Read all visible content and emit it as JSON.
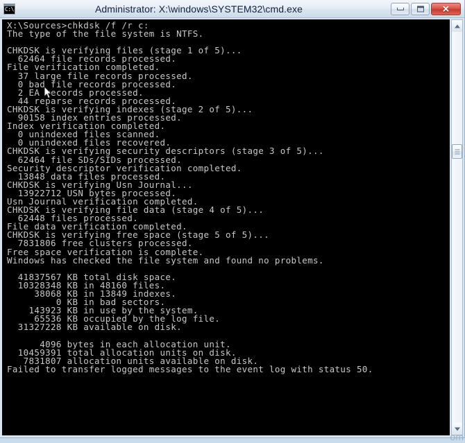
{
  "window": {
    "title": "Administrator: X:\\windows\\SYSTEM32\\cmd.exe",
    "icon_name": "cmd-prompt-icon",
    "icon_text": "C:\\.",
    "minimize_label": "Minimize",
    "maximize_label": "Maximize",
    "close_label": "Close",
    "close_glyph": "✕",
    "colors": {
      "titlebar_top": "#f2f6fb",
      "titlebar_bottom": "#cfdbe9",
      "title_text": "#11223b",
      "close_button": "#c43a2e",
      "console_background": "#000000",
      "console_text": "#c8c8c8",
      "window_border": "#91b4cf",
      "desktop": "#b9d3e8"
    }
  },
  "console": {
    "prompt": "X:\\Sources>",
    "command": "chkdsk /f /r c:",
    "lines": [
      "X:\\Sources>chkdsk /f /r c:",
      "The type of the file system is NTFS.",
      "",
      "CHKDSK is verifying files (stage 1 of 5)...",
      "  62464 file records processed.",
      "File verification completed.",
      "  37 large file records processed.",
      "  0 bad file records processed.",
      "  2 EA records processed.",
      "  44 reparse records processed.",
      "CHKDSK is verifying indexes (stage 2 of 5)...",
      "  90158 index entries processed.",
      "Index verification completed.",
      "  0 unindexed files scanned.",
      "  0 unindexed files recovered.",
      "CHKDSK is verifying security descriptors (stage 3 of 5)...",
      "  62464 file SDs/SIDs processed.",
      "Security descriptor verification completed.",
      "  13848 data files processed.",
      "CHKDSK is verifying Usn Journal...",
      "  13922712 USN bytes processed.",
      "Usn Journal verification completed.",
      "CHKDSK is verifying file data (stage 4 of 5)...",
      "  62448 files processed.",
      "File data verification completed.",
      "CHKDSK is verifying free space (stage 5 of 5)...",
      "  7831806 free clusters processed.",
      "Free space verification is complete.",
      "Windows has checked the file system and found no problems.",
      "",
      "  41837567 KB total disk space.",
      "  10328348 KB in 48160 files.",
      "     38068 KB in 13849 indexes.",
      "         0 KB in bad sectors.",
      "    143923 KB in use by the system.",
      "     65536 KB occupied by the log file.",
      "  31327228 KB available on disk.",
      "",
      "      4096 bytes in each allocation unit.",
      "  10459391 total allocation units on disk.",
      "   7831807 allocation units available on disk."
    ],
    "final_line": "Failed to transfer logged messages to the event log with status 50.",
    "stats": {
      "total_disk_space_kb": 41837567,
      "in_files_kb": 10328348,
      "file_count": 48160,
      "in_indexes_kb": 38068,
      "index_count": 13849,
      "bad_sectors_kb": 0,
      "in_use_by_system_kb": 143923,
      "log_file_kb": 65536,
      "available_kb": 31327228,
      "bytes_per_allocation_unit": 4096,
      "total_allocation_units": 10459391,
      "available_allocation_units": 7831807
    }
  },
  "scrollbar": {
    "up_arrow_label": "Scroll up",
    "down_arrow_label": "Scroll down",
    "thumb_label": "Scroll thumb"
  },
  "watermark": {
    "text": "om"
  }
}
